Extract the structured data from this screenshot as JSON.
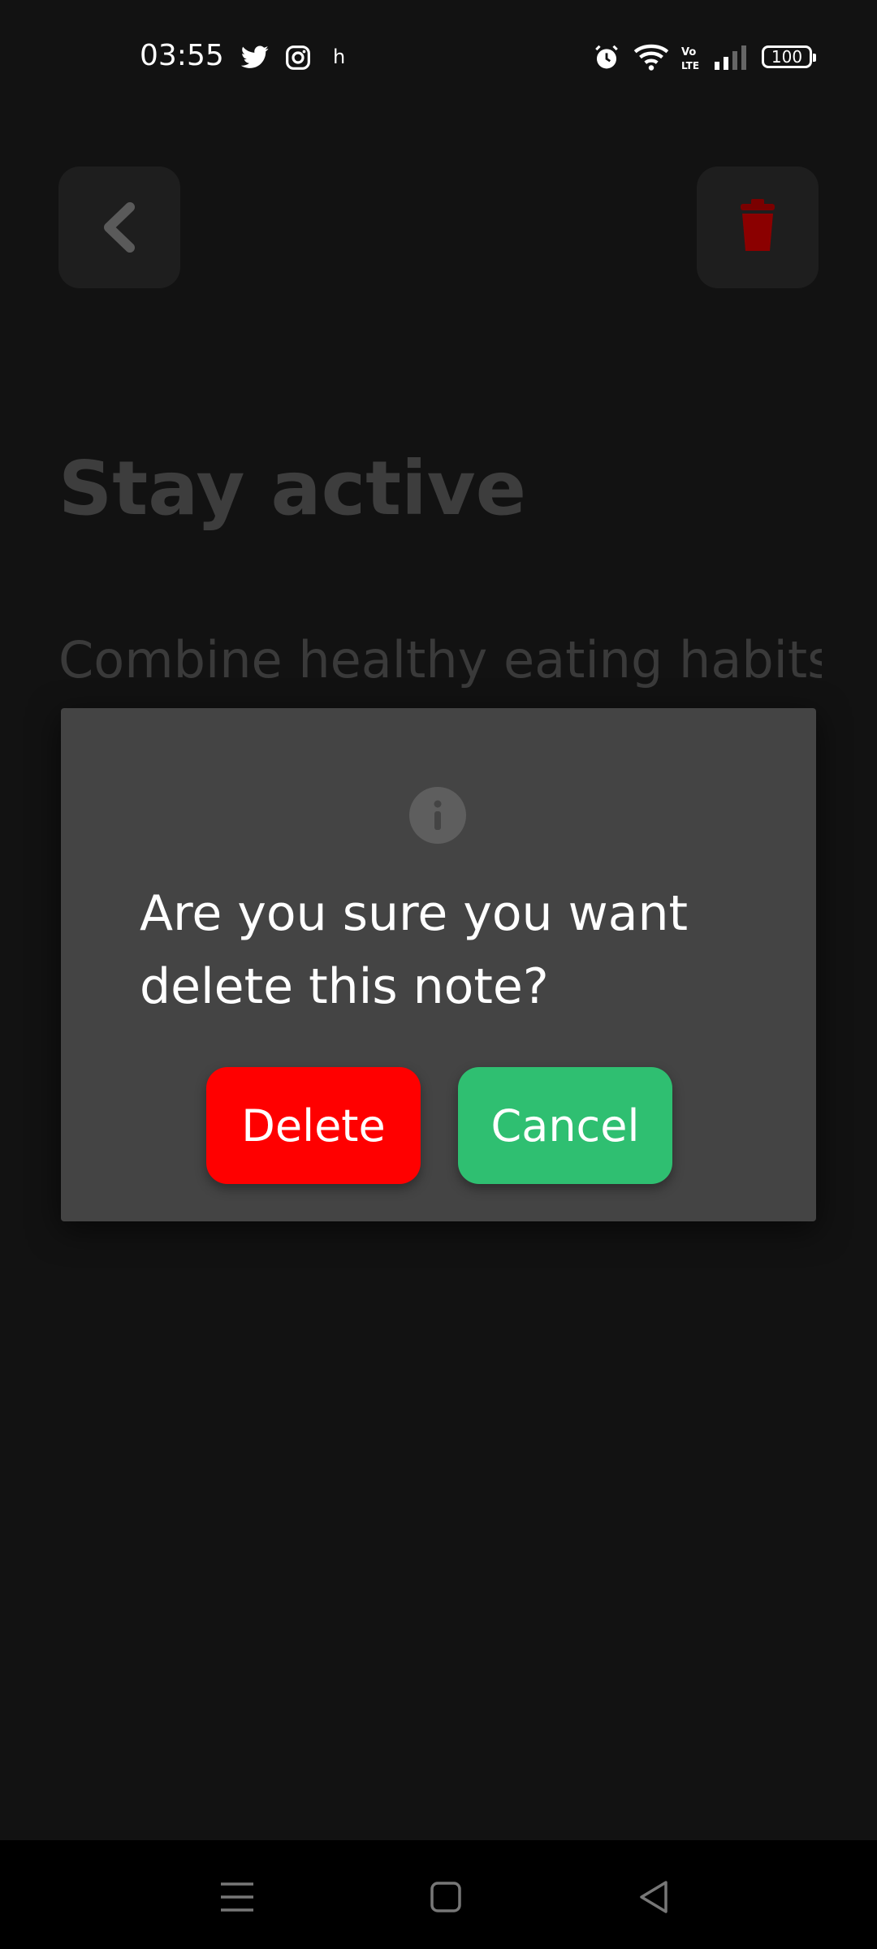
{
  "status_bar": {
    "time": "03:55",
    "notification_letter": "h",
    "battery": "100",
    "icons": [
      "twitter-icon",
      "instagram-icon",
      "alarm-icon",
      "wifi-icon",
      "volte-icon",
      "signal-icon",
      "battery-icon"
    ]
  },
  "note": {
    "title": "Stay active",
    "body": "Combine healthy eating habits"
  },
  "dialog": {
    "message": "Are you sure you want delete this note?",
    "delete_label": "Delete",
    "cancel_label": "Cancel",
    "icon": "info-icon"
  },
  "colors": {
    "background": "#121212",
    "dialog": "#444444",
    "delete": "#ff0000",
    "cancel": "#2fbf71",
    "trash": "#8b0000"
  },
  "navigation": {
    "icons": [
      "menu-icon",
      "home-icon",
      "back-icon"
    ]
  }
}
